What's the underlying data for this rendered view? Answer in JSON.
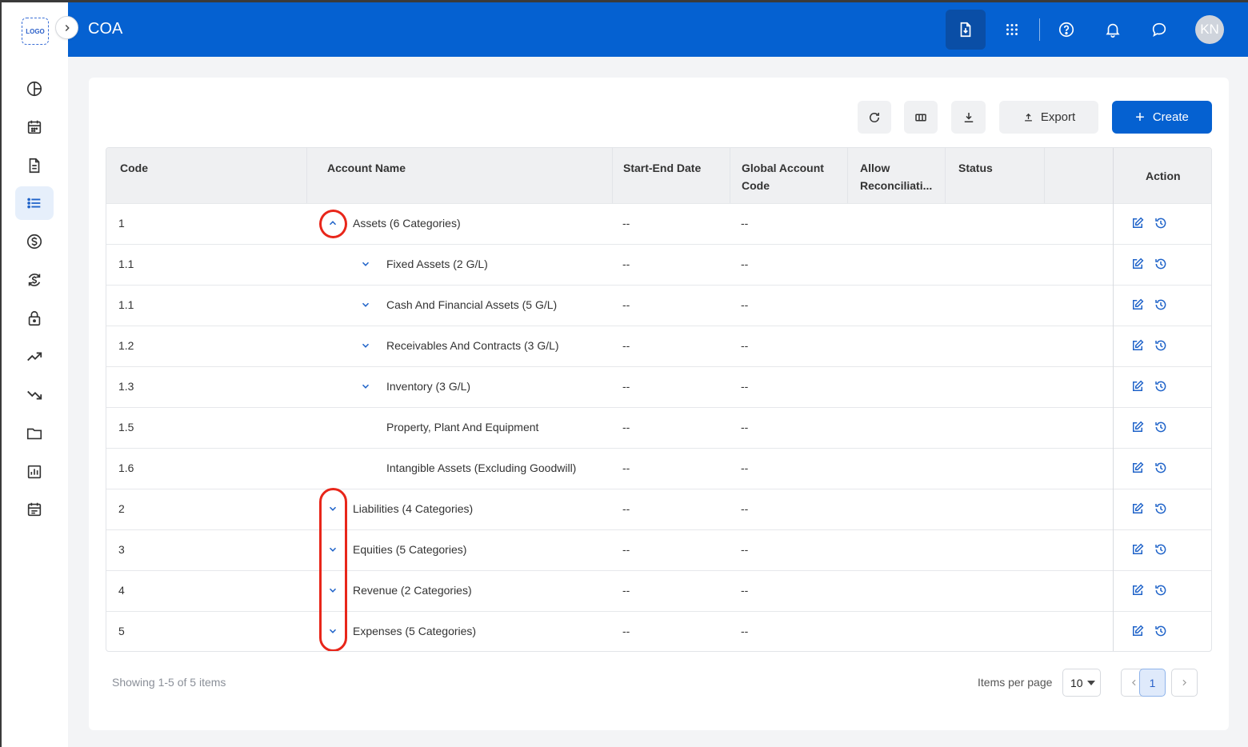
{
  "app": {
    "logo_text": "LOGO",
    "title": "COA",
    "avatar_initials": "KN"
  },
  "sidebar": {
    "items": [
      {
        "icon": "pie-chart-icon"
      },
      {
        "icon": "calendar-icon"
      },
      {
        "icon": "document-icon"
      },
      {
        "icon": "list-icon",
        "active": true
      },
      {
        "icon": "dollar-circle-icon"
      },
      {
        "icon": "currency-exchange-icon"
      },
      {
        "icon": "lock-icon"
      },
      {
        "icon": "trending-up-icon"
      },
      {
        "icon": "trending-down-icon"
      },
      {
        "icon": "folder-icon"
      },
      {
        "icon": "bar-chart-icon"
      },
      {
        "icon": "schedule-icon"
      }
    ]
  },
  "header": {
    "icons": [
      "document-download-icon",
      "apps-grid-icon",
      "help-icon",
      "bell-icon",
      "chat-icon"
    ]
  },
  "toolbar": {
    "export_label": "Export",
    "create_label": "Create"
  },
  "table": {
    "columns": {
      "code": "Code",
      "account_name": "Account Name",
      "start_end_date": "Start-End Date",
      "global_account_code_1": "Global Account",
      "global_account_code_2": "Code",
      "allow_reconciliation_1": "Allow",
      "allow_reconciliation_2": "Reconciliati...",
      "status": "Status",
      "action": "Action"
    },
    "rows": [
      {
        "code": "1",
        "name": "Assets (6 Categories)",
        "date": "--",
        "global_code": "--"
      },
      {
        "code": "1.1",
        "name": "Fixed Assets (2 G/L)",
        "date": "--",
        "global_code": "--"
      },
      {
        "code": "1.1",
        "name": "Cash And Financial Assets (5 G/L)",
        "date": "--",
        "global_code": "--"
      },
      {
        "code": "1.2",
        "name": "Receivables And Contracts (3 G/L)",
        "date": "--",
        "global_code": "--"
      },
      {
        "code": "1.3",
        "name": "Inventory (3 G/L)",
        "date": "--",
        "global_code": "--"
      },
      {
        "code": "1.5",
        "name": "Property, Plant And Equipment",
        "date": "--",
        "global_code": "--"
      },
      {
        "code": "1.6",
        "name": "Intangible Assets (Excluding Goodwill)",
        "date": "--",
        "global_code": "--"
      },
      {
        "code": "2",
        "name": "Liabilities (4 Categories)",
        "date": "--",
        "global_code": "--"
      },
      {
        "code": "3",
        "name": "Equities (5 Categories)",
        "date": "--",
        "global_code": "--"
      },
      {
        "code": "4",
        "name": "Revenue (2 Categories)",
        "date": "--",
        "global_code": "--"
      },
      {
        "code": "5",
        "name": "Expenses (5 Categories)",
        "date": "--",
        "global_code": "--"
      }
    ]
  },
  "footer": {
    "showing": "Showing 1-5 of 5 items",
    "items_per_page_label": "Items per page",
    "items_per_page_value": "10",
    "current_page": "1"
  },
  "colors": {
    "brand": "#0561d1",
    "highlight": "#e8261a",
    "icon_blue": "#1f63c9"
  }
}
